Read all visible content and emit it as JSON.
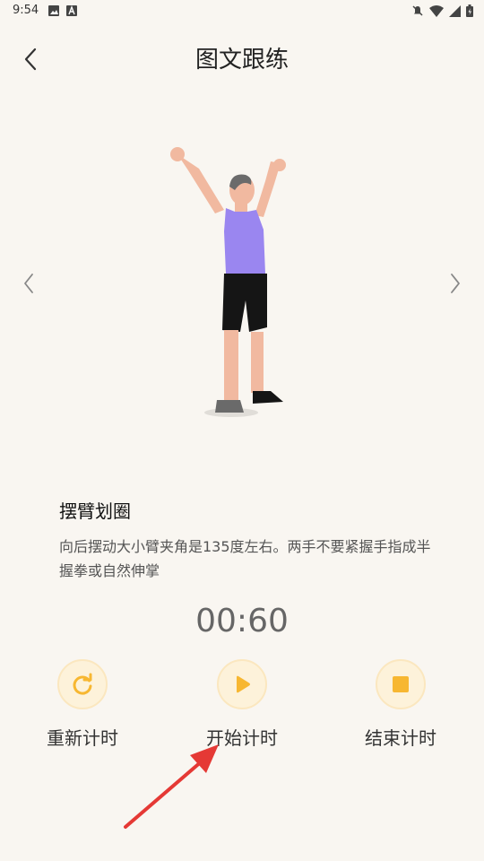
{
  "status_bar": {
    "time": "9:54",
    "left_icons": [
      "image-icon",
      "font-icon"
    ],
    "right_icons": [
      "notifications-off-icon",
      "wifi-icon",
      "signal-icon",
      "battery-icon"
    ]
  },
  "header": {
    "title": "图文跟练",
    "back_icon": "chevron-left-icon"
  },
  "exercise": {
    "name": "摆臂划圈",
    "description": "向后摆动大小臂夹角是135度左右。两手不要紧握手指成半握拳或自然伸掌"
  },
  "timer": {
    "display": "00:60"
  },
  "controls": {
    "restart_label": "重新计时",
    "start_label": "开始计时",
    "end_label": "结束计时"
  },
  "colors": {
    "background": "#f9f6f1",
    "accent": "#f7b731",
    "ring": "#fdf2da",
    "annotation": "#e53935"
  }
}
